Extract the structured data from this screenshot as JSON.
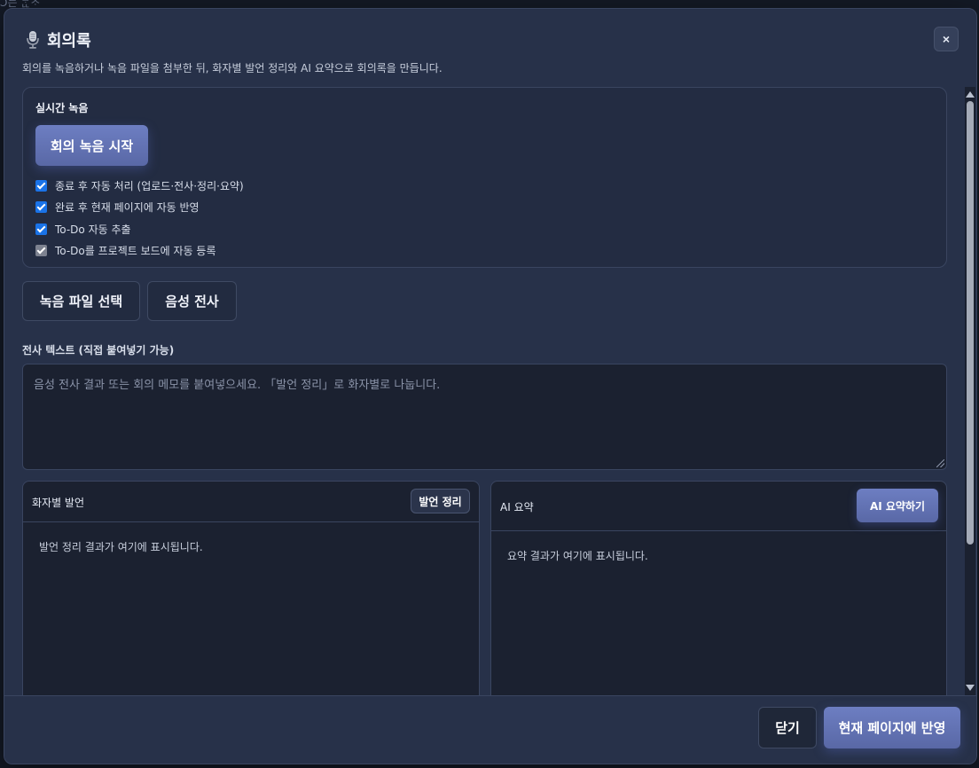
{
  "background": {
    "fragment": "Ͻ는 ᄒᆞᆫᆫᄌᆞ"
  },
  "header": {
    "icon": "microphone-icon",
    "title": "회의록",
    "close_label": "×"
  },
  "description": "회의를 녹음하거나 녹음 파일을 첨부한 뒤, 화자별 발언 정리와 AI 요약으로 회의록을 만듭니다.",
  "live_recording": {
    "title": "실시간 녹음",
    "start_button": "회의 녹음 시작",
    "options": [
      {
        "label": "종료 후 자동 처리 (업로드·전사·정리·요약)",
        "checked": true,
        "disabled": false
      },
      {
        "label": "완료 후 현재 페이지에 자동 반영",
        "checked": true,
        "disabled": false
      },
      {
        "label": "To-Do 자동 추출",
        "checked": true,
        "disabled": false
      },
      {
        "label": "To-Do를 프로젝트 보드에 자동 등록",
        "checked": true,
        "disabled": true
      }
    ]
  },
  "actions": {
    "select_file": "녹음 파일 선택",
    "transcribe": "음성 전사"
  },
  "transcript": {
    "label": "전사 텍스트 (직접 붙여넣기 가능)",
    "placeholder": "음성 전사 결과 또는 회의 메모를 붙여넣으세요. 「발언 정리」로 화자별로 나눕니다.",
    "value": ""
  },
  "speaker_panel": {
    "title": "화자별 발언",
    "button": "발언 정리",
    "empty_text": "발언 정리 결과가 여기에 표시됩니다."
  },
  "summary_panel": {
    "title": "AI 요약",
    "button": "AI 요약하기",
    "empty_text": "요약 결과가 여기에 표시됩니다."
  },
  "footer": {
    "close": "닫기",
    "apply": "현재 페이지에 반영"
  },
  "colors": {
    "modal_bg": "#273149",
    "accent": "#6d7ec2",
    "checkbox": "#1a73e8"
  }
}
